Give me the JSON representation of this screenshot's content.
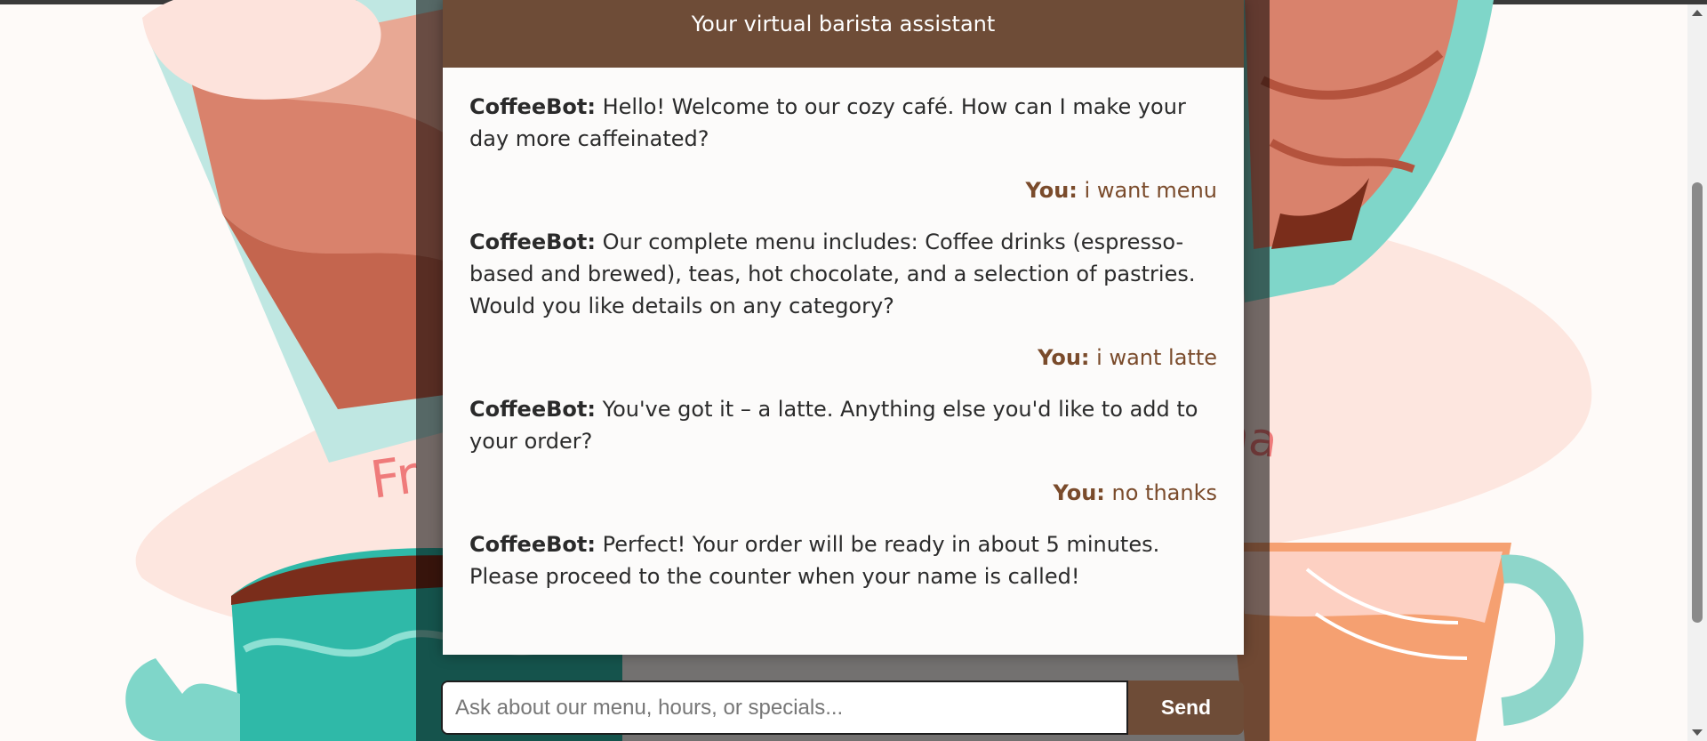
{
  "header": {
    "title": "Your virtual barista assistant"
  },
  "messages": [
    {
      "sender": "CoffeeBot:",
      "text": "Hello! Welcome to our cozy café. How can I make your day more caffeinated?"
    },
    {
      "sender": "You:",
      "text": "i want menu"
    },
    {
      "sender": "CoffeeBot:",
      "text": "Our complete menu includes: Coffee drinks (espresso-based and brewed), teas, hot chocolate, and a selection of pastries. Would you like details on any category?"
    },
    {
      "sender": "You:",
      "text": "i want latte"
    },
    {
      "sender": "CoffeeBot:",
      "text": "You've got it – a latte. Anything else you'd like to add to your order?"
    },
    {
      "sender": "You:",
      "text": "no thanks"
    },
    {
      "sender": "CoffeeBot:",
      "text": "Perfect! Your order will be ready in about 5 minutes. Please proceed to the counter when your name is called!"
    }
  ],
  "input": {
    "placeholder": "Ask about our menu, hours, or specials...",
    "value": ""
  },
  "send_button": {
    "label": "Send"
  },
  "background": {
    "decor_text_left": "Fr",
    "decor_text_right": "ha"
  },
  "colors": {
    "header": "#6e4c37",
    "user_text": "#7a4b2b",
    "accent_teal": "#3cc3b3"
  }
}
